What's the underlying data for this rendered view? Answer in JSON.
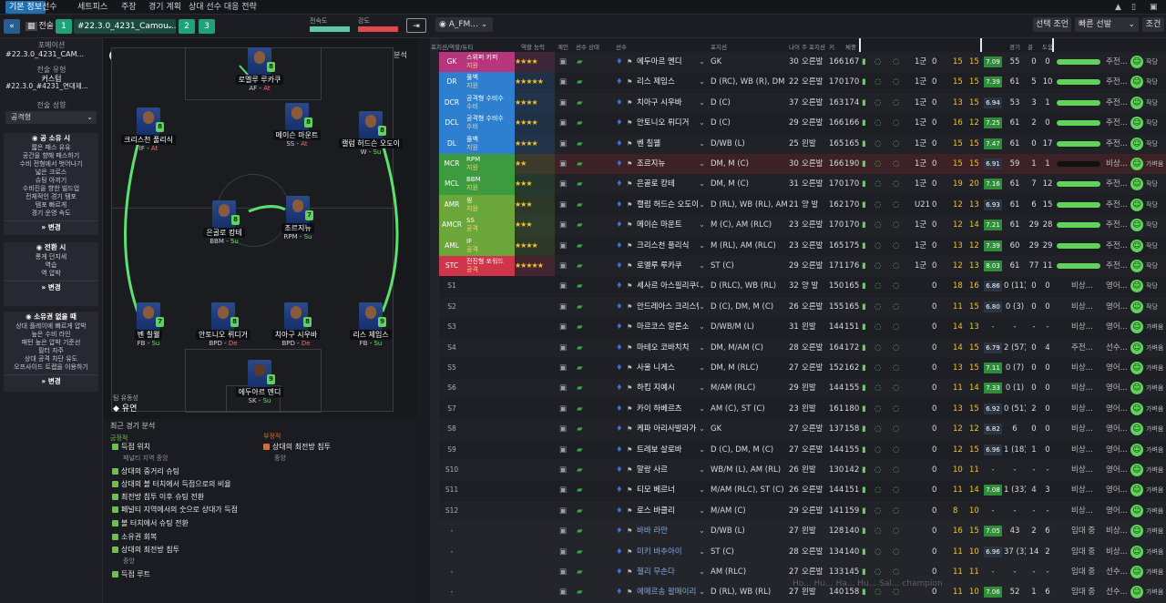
{
  "nav": {
    "tabs": [
      "기본 정보",
      "선수",
      "세트피스",
      "주장",
      "경기 계획",
      "상대 선수 대응 전략"
    ],
    "active": 0
  },
  "bar2": {
    "tactic_label": "전술",
    "num1": "1",
    "tactic_name": "#22.3.0_4231_Camou...",
    "num2": "2",
    "num3": "3",
    "firmness_label": "전숙도",
    "intensity_label": "강도",
    "view": "A_FM...",
    "select_btn": "선택 조언",
    "quick_btn": "빠른 선발",
    "search_btn": "조건"
  },
  "left": {
    "formation_label": "포메이션",
    "formation_value": "#22.3.0_4231_CAM...",
    "style_label": "전술 유형",
    "style_value": "커스텀",
    "style_sub": "#22.3.0_#4231_연대제...",
    "mentality_label": "전술 성향",
    "mentality_value": "공격형",
    "box1": {
      "title": "공 소유 시",
      "items": [
        "짧은 패스 유유",
        "공간을 향해 패스하기",
        "수비 전형에서 벗어나기",
        "넓은 크로스",
        "슈팅 아끼기",
        "수비진을 향한 빌드업",
        "전체적인 경기 템포",
        "템포 빠르게",
        "경기 운영 속도"
      ],
      "btn": "변경"
    },
    "box2": {
      "title": "전환 시",
      "items": [
        "롱게 던지세",
        "역습",
        "역 압박"
      ],
      "btn": "변경"
    },
    "box3": {
      "title": "소유권 없을 때",
      "items": [
        "상대 플레이에 빠르게 압박",
        "높은 수비 라인",
        "패턴 높은 압박 기준선",
        "필터 자주",
        "상대 공격 차단 유도",
        "오프사이드 트랩을 이용하기"
      ],
      "btn": "변경"
    }
  },
  "pitch": {
    "analysis_btn": "분석",
    "team_fluidity_label": "팀 유동성",
    "team_fluidity_value": "유연",
    "players": [
      {
        "name": "로멜루 루카쿠",
        "role": "AF",
        "duty": "At",
        "rating": "8"
      },
      {
        "name": "크리스천 풀리식",
        "role": "IF",
        "duty": "At",
        "rating": "8"
      },
      {
        "name": "메이슨 마운트",
        "role": "SS",
        "duty": "At",
        "rating": "8"
      },
      {
        "name": "캘럼 허드슨 오도이",
        "role": "W",
        "duty": "Su",
        "rating": "8"
      },
      {
        "name": "은골로 캉테",
        "role": "BBM",
        "duty": "Su",
        "rating": "8"
      },
      {
        "name": "조르지뉴",
        "role": "RPM",
        "duty": "Su",
        "rating": "7"
      },
      {
        "name": "벤 칠웰",
        "role": "FB",
        "duty": "Su",
        "rating": "7"
      },
      {
        "name": "안토니오 뤼디거",
        "role": "BPD",
        "duty": "De",
        "rating": "8"
      },
      {
        "name": "치아구 시우바",
        "role": "BPD",
        "duty": "De",
        "rating": "8"
      },
      {
        "name": "리스 제임스",
        "role": "FB",
        "duty": "Su",
        "rating": "9"
      },
      {
        "name": "에두아르 멘디",
        "role": "SK",
        "duty": "Su",
        "rating": "9"
      }
    ]
  },
  "analysis": {
    "title": "최근 경기 분석",
    "pos_title": "긍정적",
    "neg_title": "부정적",
    "positives": [
      {
        "text": "득점 위치",
        "sub": "페널티 지역 중앙"
      },
      {
        "text": "상대의 중거리 슈팅",
        "sub": ""
      },
      {
        "text": "상대의 볼 터치에서 득점으로의 비율",
        "sub": ""
      },
      {
        "text": "최전방 침투 이후 슈팅 전환",
        "sub": ""
      },
      {
        "text": "페널티 지역에서의 숫으로 상대가 득점",
        "sub": ""
      },
      {
        "text": "볼 터치에서 슈팅 전환",
        "sub": ""
      },
      {
        "text": "소유권 회복",
        "sub": ""
      },
      {
        "text": "상대의 최전방 침투",
        "sub": "중앙"
      },
      {
        "text": "득점 루트",
        "sub": ""
      }
    ],
    "negatives": [
      {
        "text": "상대의 최전방 침투",
        "sub": "중앙"
      }
    ]
  },
  "table": {
    "headers": [
      "포지션/역할/듀티",
      "역할 능력",
      "계인",
      "선수 상태",
      "선수",
      "포지션",
      "나이",
      "주 포지션",
      "키",
      "체중",
      "",
      "",
      "",
      "부상",
      "구분",
      "",
      "경기",
      "골",
      "도움",
      "",
      "",
      "",
      "",
      "",
      ""
    ],
    "rows": [
      {
        "pos": "GK",
        "role": "스위퍼 키퍼",
        "duty": "지원",
        "stars": "★★★★",
        "name": "에두아르 멘디",
        "position": "GK",
        "age": "30",
        "foot": "오른발",
        "h": "166",
        "w": "167",
        "gr": "1군",
        "c1": "0",
        "c2": "15",
        "c3": "15",
        "avg": "7.09",
        "gp": "55",
        "g": "0",
        "a": "0",
        "s1": "중요...",
        "s2": "주전...",
        "color": "#b5367a"
      },
      {
        "pos": "DR",
        "role": "풀백",
        "duty": "지원",
        "stars": "★★★★★",
        "name": "리스 제임스",
        "position": "D (RC), WB (R), DM",
        "age": "22",
        "foot": "오른발",
        "h": "170",
        "w": "170",
        "gr": "1군",
        "c1": "0",
        "c2": "15",
        "c3": "15",
        "avg": "7.39",
        "gp": "61",
        "g": "5",
        "a": "10",
        "s1": "중요...",
        "s2": "주전...",
        "color": "#2e7fd0"
      },
      {
        "pos": "DCR",
        "role": "공격형 수비수",
        "duty": "수비",
        "stars": "★★★★",
        "name": "치아구 시우바",
        "position": "D (C)",
        "age": "37",
        "foot": "오른발",
        "h": "163",
        "w": "174",
        "gr": "1군",
        "c1": "0",
        "c2": "13",
        "c3": "15",
        "avg": "6.94",
        "gp": "53",
        "g": "3",
        "a": "1",
        "s1": "중요...",
        "s2": "주전...",
        "color": "#2e7fd0"
      },
      {
        "pos": "DCL",
        "role": "공격형 수비수",
        "duty": "수비",
        "stars": "★★★★",
        "name": "안토니오 뤼디거",
        "position": "D (C)",
        "age": "29",
        "foot": "오른발",
        "h": "166",
        "w": "166",
        "gr": "1군",
        "c1": "0",
        "c2": "16",
        "c3": "12",
        "avg": "7.25",
        "gp": "61",
        "g": "2",
        "a": "0",
        "s1": "중요...",
        "s2": "주전...",
        "color": "#2e7fd0"
      },
      {
        "pos": "DL",
        "role": "풀백",
        "duty": "지원",
        "stars": "★★★★",
        "name": "벤 칠웰",
        "position": "D/WB (L)",
        "age": "25",
        "foot": "왼발",
        "h": "165",
        "w": "165",
        "gr": "1군",
        "c1": "0",
        "c2": "15",
        "c3": "15",
        "avg": "7.47",
        "gp": "61",
        "g": "0",
        "a": "17",
        "s1": "중요...",
        "s2": "주전...",
        "color": "#2e7fd0"
      },
      {
        "pos": "MCR",
        "role": "RPM",
        "duty": "지원",
        "stars": "★★",
        "name": "조르지뉴",
        "position": "DM, M (C)",
        "age": "30",
        "foot": "오른발",
        "h": "166",
        "w": "190",
        "gr": "1군",
        "c1": "0",
        "c2": "15",
        "c3": "15",
        "avg": "6.91",
        "gp": "59",
        "g": "1",
        "a": "1",
        "s1": "가벼운",
        "s2": "비상...",
        "color": "#3e9a3e"
      },
      {
        "pos": "MCL",
        "role": "BBM",
        "duty": "지원",
        "stars": "★★★",
        "name": "은골로 캉테",
        "position": "DM, M (C)",
        "age": "31",
        "foot": "오른발",
        "h": "170",
        "w": "170",
        "gr": "1군",
        "c1": "0",
        "c2": "19",
        "c3": "20",
        "avg": "7.16",
        "gp": "61",
        "g": "7",
        "a": "12",
        "s1": "중요...",
        "s2": "주전...",
        "color": "#3e9a3e"
      },
      {
        "pos": "AMR",
        "role": "윙",
        "duty": "지원",
        "stars": "★★★",
        "name": "캘럼 허드슨 오도이",
        "position": "D (RL), WB (RL), AM...",
        "age": "21",
        "foot": "양 발",
        "h": "162",
        "w": "170",
        "gr": "U21",
        "c1": "0",
        "c2": "12",
        "c3": "13",
        "avg": "6.93",
        "gp": "61",
        "g": "6",
        "a": "15",
        "s1": "중요...",
        "s2": "주전...",
        "color": "#6aa63a"
      },
      {
        "pos": "AMCR",
        "role": "SS",
        "duty": "공격",
        "stars": "★★★",
        "name": "메이슨 마운트",
        "position": "M (C), AM (RLC)",
        "age": "23",
        "foot": "오른발",
        "h": "170",
        "w": "170",
        "gr": "1군",
        "c1": "0",
        "c2": "12",
        "c3": "14",
        "avg": "7.21",
        "gp": "61",
        "g": "29",
        "a": "28",
        "s1": "중요...",
        "s2": "주전...",
        "color": "#6aa63a"
      },
      {
        "pos": "AML",
        "role": "IF",
        "duty": "공격",
        "stars": "★★★★",
        "name": "크리스천 풀리식",
        "position": "M (RL), AM (RLC)",
        "age": "23",
        "foot": "오른발",
        "h": "165",
        "w": "175",
        "gr": "1군",
        "c1": "0",
        "c2": "13",
        "c3": "12",
        "avg": "7.39",
        "gp": "60",
        "g": "29",
        "a": "29",
        "s1": "중요...",
        "s2": "주전...",
        "color": "#6aa63a"
      },
      {
        "pos": "STC",
        "role": "전진형 포워드",
        "duty": "공격",
        "stars": "★★★★★",
        "name": "로멜루 루카쿠",
        "position": "ST (C)",
        "age": "29",
        "foot": "오른발",
        "h": "171",
        "w": "176",
        "gr": "1군",
        "c1": "0",
        "c2": "12",
        "c3": "13",
        "avg": "8.03",
        "gp": "61",
        "g": "77",
        "a": "11",
        "s1": "중요...",
        "s2": "주전...",
        "color": "#d0344a"
      },
      {
        "pos": "S1",
        "name": "세사르 아스필리쿠에타",
        "position": "D (RLC), WB (RL)",
        "age": "32",
        "foot": "양 발",
        "h": "150",
        "w": "165",
        "c2": "18",
        "c3": "16",
        "avg": "6.86",
        "gp": "0 (11)",
        "g": "0",
        "a": "0",
        "s1": "영어...",
        "s2": "비상..."
      },
      {
        "pos": "S2",
        "name": "안드레아스 크리스텐센",
        "position": "D (C), DM, M (C)",
        "age": "26",
        "foot": "오른발",
        "h": "155",
        "w": "165",
        "c2": "11",
        "c3": "15",
        "avg": "6.80",
        "gp": "0 (3)",
        "g": "0",
        "a": "0",
        "s1": "영어...",
        "s2": "비상..."
      },
      {
        "pos": "S3",
        "name": "마르코스 알론소",
        "position": "D/WB/M (L)",
        "age": "31",
        "foot": "왼발",
        "h": "144",
        "w": "151",
        "c2": "14",
        "c3": "13",
        "avg": "-",
        "gp": "-",
        "g": "-",
        "a": "-",
        "s1": "영어...",
        "s2": "비상..."
      },
      {
        "pos": "S4",
        "name": "마테오 코바치치",
        "position": "DM, M/AM (C)",
        "age": "28",
        "foot": "오른발",
        "h": "164",
        "w": "172",
        "c2": "14",
        "c3": "15",
        "avg": "6.79",
        "gp": "2 (57)",
        "g": "0",
        "a": "4",
        "s1": "선수...",
        "s2": "주전..."
      },
      {
        "pos": "S5",
        "name": "사울 니게스",
        "position": "DM, M (RLC)",
        "age": "27",
        "foot": "오른발",
        "h": "152",
        "w": "162",
        "c2": "13",
        "c3": "15",
        "avg": "7.11",
        "gp": "0 (7)",
        "g": "0",
        "a": "0",
        "s1": "영어...",
        "s2": "비상..."
      },
      {
        "pos": "S6",
        "name": "하킴 지예시",
        "position": "M/AM (RLC)",
        "age": "29",
        "foot": "왼발",
        "h": "144",
        "w": "155",
        "c2": "11",
        "c3": "14",
        "avg": "7.33",
        "gp": "0 (1)",
        "g": "0",
        "a": "0",
        "s1": "영어...",
        "s2": "비상..."
      },
      {
        "pos": "S7",
        "name": "카이 하베르츠",
        "position": "AM (C), ST (C)",
        "age": "23",
        "foot": "왼발",
        "h": "161",
        "w": "180",
        "c2": "13",
        "c3": "15",
        "avg": "6.92",
        "gp": "0 (51)",
        "g": "2",
        "a": "0",
        "s1": "영어...",
        "s2": "비상..."
      },
      {
        "pos": "S8",
        "name": "케파 아리사발라가",
        "position": "GK",
        "age": "27",
        "foot": "오른발",
        "h": "137",
        "w": "158",
        "c2": "12",
        "c3": "12",
        "avg": "6.82",
        "gp": "6",
        "g": "0",
        "a": "0",
        "s1": "영어...",
        "s2": "비상..."
      },
      {
        "pos": "S9",
        "name": "트레보 살로바",
        "position": "D (C), DM, M (C)",
        "age": "27",
        "foot": "오른발",
        "h": "144",
        "w": "155",
        "c2": "12",
        "c3": "15",
        "avg": "6.96",
        "gp": "1 (18)",
        "g": "1",
        "a": "0",
        "s1": "영어...",
        "s2": "비상..."
      },
      {
        "pos": "S10",
        "name": "말랑 사르",
        "position": "WB/M (L), AM (RL)",
        "age": "26",
        "foot": "왼발",
        "h": "130",
        "w": "142",
        "c2": "10",
        "c3": "11",
        "avg": "-",
        "gp": "-",
        "g": "-",
        "a": "-",
        "s1": "영어...",
        "s2": "비상..."
      },
      {
        "pos": "S11",
        "name": "티모 베르너",
        "position": "M/AM (RLC), ST (C)",
        "age": "26",
        "foot": "오른발",
        "h": "144",
        "w": "151",
        "c2": "11",
        "c3": "14",
        "avg": "7.08",
        "gp": "1 (33)",
        "g": "4",
        "a": "3",
        "s1": "영어...",
        "s2": "비상..."
      },
      {
        "pos": "S12",
        "name": "로스 바클리",
        "position": "M/AM (C)",
        "age": "29",
        "foot": "오른발",
        "h": "141",
        "w": "159",
        "c2": "8",
        "c3": "10",
        "avg": "-",
        "gp": "-",
        "g": "-",
        "a": "-",
        "s1": "영어...",
        "s2": "비상..."
      },
      {
        "pos": "-",
        "name": "바바 라만",
        "position": "D/WB (L)",
        "age": "27",
        "foot": "왼발",
        "h": "128",
        "w": "140",
        "c2": "16",
        "c3": "15",
        "avg": "7.05",
        "gp": "43",
        "g": "2",
        "a": "6",
        "s1": "비상...",
        "s2": "임대 중"
      },
      {
        "pos": "-",
        "name": "미키 바추아이",
        "position": "ST (C)",
        "age": "28",
        "foot": "오른발",
        "h": "134",
        "w": "140",
        "c2": "11",
        "c3": "10",
        "avg": "6.96",
        "gp": "37 (3)",
        "g": "14",
        "a": "2",
        "s1": "비상...",
        "s2": "임대 중"
      },
      {
        "pos": "-",
        "name": "첼리 무손다",
        "position": "AM (RLC)",
        "age": "27",
        "foot": "오른발",
        "h": "133",
        "w": "145",
        "c2": "11",
        "c3": "11",
        "avg": "-",
        "gp": "-",
        "g": "-",
        "a": "-",
        "s1": "선수...",
        "s2": "임대 중"
      },
      {
        "pos": "-",
        "name": "에메르송 팔메이리",
        "position": "D (RL), WB (RL)",
        "age": "27",
        "foot": "왼발",
        "h": "140",
        "w": "158",
        "c2": "11",
        "c3": "10",
        "avg": "7.06",
        "gp": "52",
        "g": "1",
        "a": "6",
        "s1": "선수...",
        "s2": "임대 중"
      }
    ]
  },
  "overlay": "Ho... Hu... Ha... Hu... Sal... champion"
}
